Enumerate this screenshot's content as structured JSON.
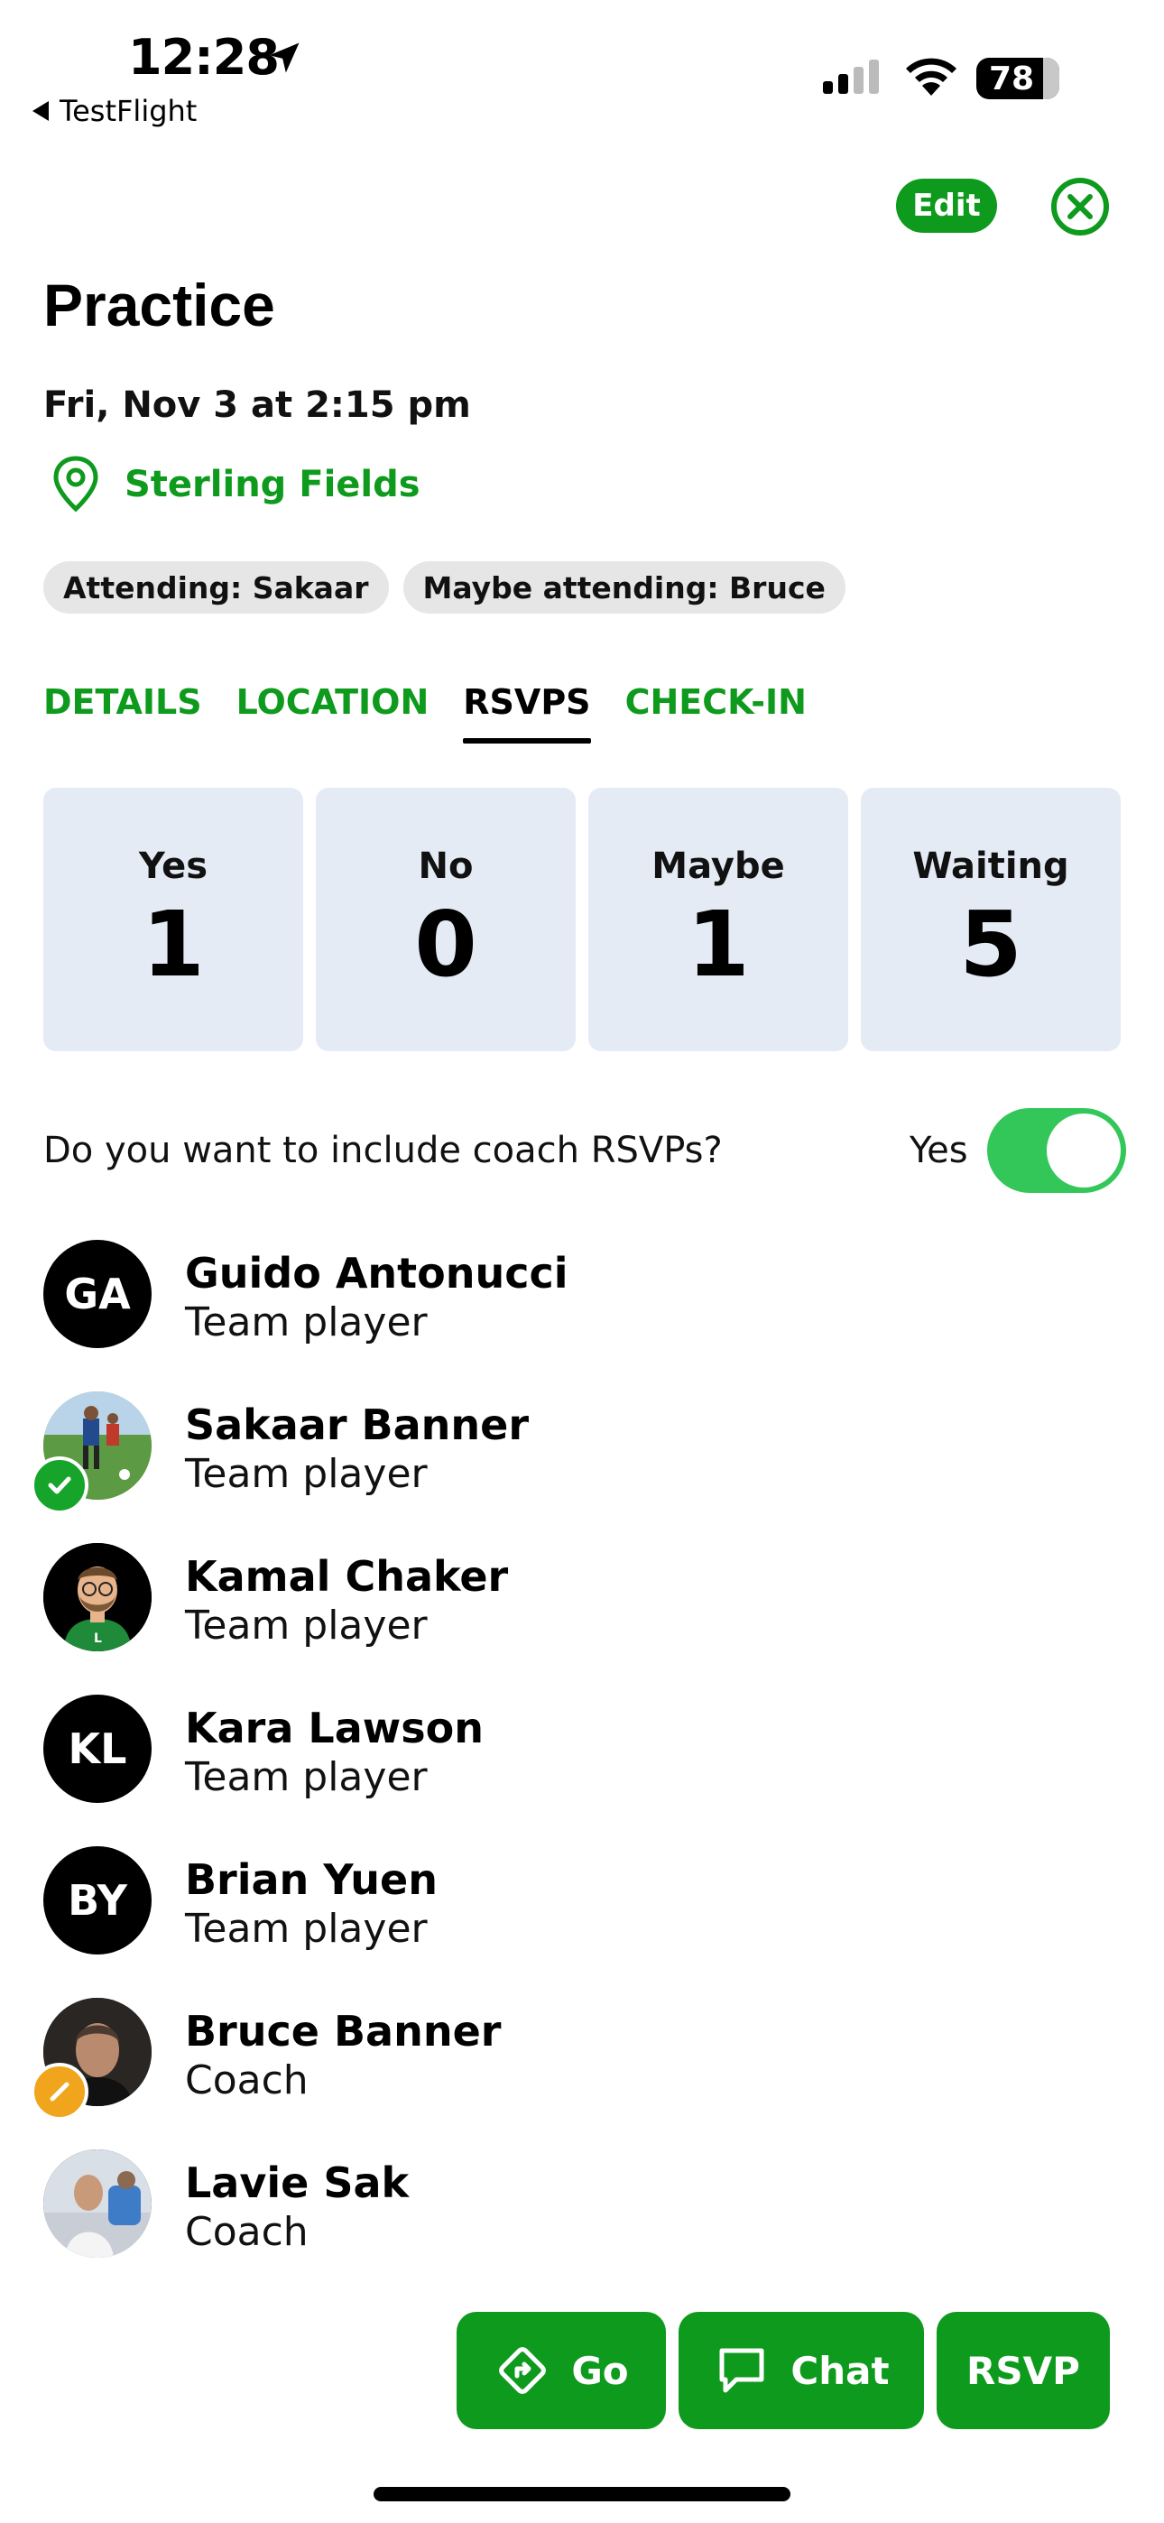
{
  "status_bar": {
    "time": "12:28",
    "back_app": "TestFlight",
    "battery": "78"
  },
  "header": {
    "edit_label": "Edit"
  },
  "event": {
    "title": "Practice",
    "datetime": "Fri, Nov 3 at 2:15 pm",
    "location": "Sterling Fields",
    "chips": [
      "Attending: Sakaar",
      "Maybe attending: Bruce"
    ]
  },
  "tabs": [
    {
      "label": "DETAILS",
      "active": false
    },
    {
      "label": "LOCATION",
      "active": false
    },
    {
      "label": "RSVPS",
      "active": true
    },
    {
      "label": "CHECK-IN",
      "active": false
    }
  ],
  "stats": [
    {
      "label": "Yes",
      "value": "1"
    },
    {
      "label": "No",
      "value": "0"
    },
    {
      "label": "Maybe",
      "value": "1"
    },
    {
      "label": "Waiting",
      "value": "5"
    }
  ],
  "coach_toggle": {
    "question": "Do you want to include coach RSVPs?",
    "state_label": "Yes",
    "on": true
  },
  "people": [
    {
      "name": "Guido Antonucci",
      "role": "Team player",
      "initials": "GA",
      "status": ""
    },
    {
      "name": "Sakaar Banner",
      "role": "Team player",
      "initials": "",
      "status": "yes"
    },
    {
      "name": "Kamal Chaker",
      "role": "Team player",
      "initials": "",
      "status": ""
    },
    {
      "name": "Kara Lawson",
      "role": "Team player",
      "initials": "KL",
      "status": ""
    },
    {
      "name": "Brian Yuen",
      "role": "Team player",
      "initials": "BY",
      "status": ""
    },
    {
      "name": "Bruce Banner",
      "role": "Coach",
      "initials": "",
      "status": "maybe"
    },
    {
      "name": "Lavie Sak",
      "role": "Coach",
      "initials": "",
      "status": ""
    }
  ],
  "actions": {
    "go": "Go",
    "chat": "Chat",
    "rsvp": "RSVP"
  },
  "colors": {
    "accent": "#0e9a1c",
    "toggle_on": "#33c759",
    "stat_bg": "#e4ebf5",
    "maybe_badge": "#f1a51d"
  }
}
